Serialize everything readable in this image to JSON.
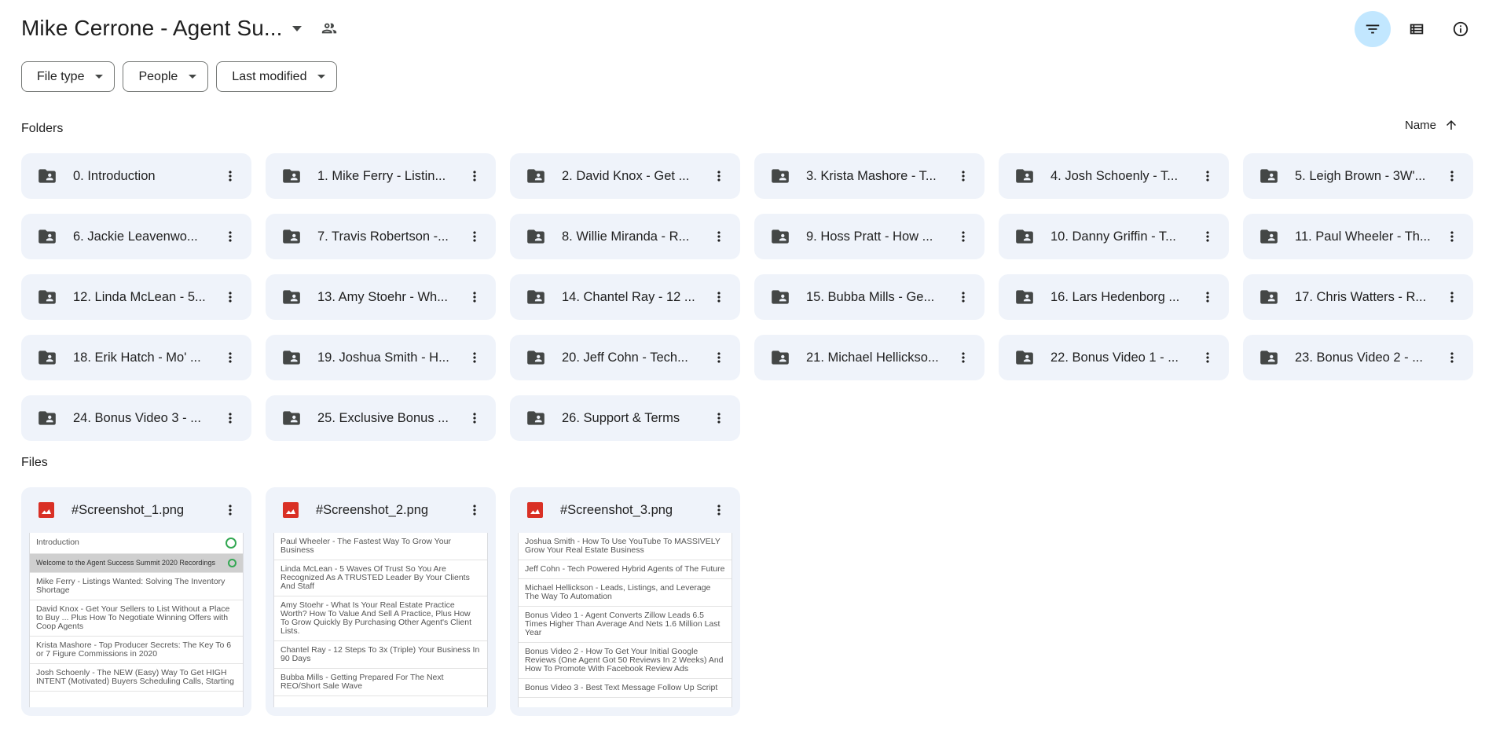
{
  "header": {
    "title": "Mike Cerrone - Agent Su...",
    "icons": [
      "caret-down-icon",
      "shared-people-icon"
    ]
  },
  "toolbar": {
    "icons": [
      "filter-icon",
      "list-view-icon",
      "info-icon"
    ],
    "active_color": "#c2e7ff"
  },
  "filters": [
    {
      "label": "File type"
    },
    {
      "label": "People"
    },
    {
      "label": "Last modified"
    }
  ],
  "folders_label": "Folders",
  "sort": {
    "label": "Name",
    "icon": "arrow-up-icon"
  },
  "folders": [
    {
      "name": "0. Introduction"
    },
    {
      "name": "1. Mike Ferry - Listin..."
    },
    {
      "name": "2. David Knox - Get ..."
    },
    {
      "name": "3. Krista Mashore - T..."
    },
    {
      "name": "4. Josh Schoenly - T..."
    },
    {
      "name": "5. Leigh Brown - 3W'..."
    },
    {
      "name": "6. Jackie Leavenwo..."
    },
    {
      "name": "7. Travis Robertson -..."
    },
    {
      "name": "8. Willie Miranda - R..."
    },
    {
      "name": "9. Hoss Pratt - How ..."
    },
    {
      "name": "10. Danny Griffin - T..."
    },
    {
      "name": "11. Paul Wheeler - Th..."
    },
    {
      "name": "12. Linda McLean - 5..."
    },
    {
      "name": "13. Amy Stoehr - Wh..."
    },
    {
      "name": "14. Chantel Ray - 12 ..."
    },
    {
      "name": "15. Bubba Mills - Ge..."
    },
    {
      "name": "16. Lars Hedenborg ..."
    },
    {
      "name": "17. Chris Watters - R..."
    },
    {
      "name": "18. Erik Hatch - Mo' ..."
    },
    {
      "name": "19. Joshua Smith - H..."
    },
    {
      "name": "20. Jeff Cohn - Tech..."
    },
    {
      "name": "21. Michael Hellickso..."
    },
    {
      "name": "22. Bonus Video 1 - ..."
    },
    {
      "name": "23. Bonus Video 2 - ..."
    },
    {
      "name": "24. Bonus Video 3 - ..."
    },
    {
      "name": "25. Exclusive Bonus ..."
    },
    {
      "name": "26. Support & Terms"
    }
  ],
  "files_label": "Files",
  "files": [
    {
      "name": "#Screenshot_1.png",
      "preview": [
        {
          "text": "Introduction",
          "ring": true
        },
        {
          "text": "Welcome to the Agent Success Summit 2020 Recordings",
          "ring": true,
          "hl": true
        },
        {
          "text": "Mike Ferry - Listings Wanted: Solving The Inventory Shortage"
        },
        {
          "text": "David Knox - Get Your Sellers to List Without a Place to Buy ... Plus How To Negotiate Winning Offers with Coop Agents"
        },
        {
          "text": "Krista Mashore - Top Producer Secrets: The Key To 6 or 7 Figure Commissions in 2020"
        },
        {
          "text": "Josh Schoenly - The NEW (Easy) Way To Get HIGH INTENT (Motivated) Buyers Scheduling Calls, Starting"
        }
      ]
    },
    {
      "name": "#Screenshot_2.png",
      "preview": [
        {
          "text": "Paul Wheeler - The Fastest Way To Grow Your Business"
        },
        {
          "text": "Linda McLean - 5 Waves Of Trust So You Are Recognized As A TRUSTED Leader By Your Clients And Staff"
        },
        {
          "text": "Amy Stoehr - What Is Your Real Estate Practice Worth? How To Value And Sell A Practice, Plus How To Grow Quickly By Purchasing Other Agent's Client Lists."
        },
        {
          "text": "Chantel Ray - 12 Steps To 3x (Triple) Your Business In 90 Days"
        },
        {
          "text": "Bubba Mills - Getting Prepared For The Next REO/Short Sale Wave"
        }
      ]
    },
    {
      "name": "#Screenshot_3.png",
      "preview": [
        {
          "text": "Joshua Smith - How To Use YouTube To MASSIVELY Grow Your Real Estate Business"
        },
        {
          "text": "Jeff Cohn - Tech Powered Hybrid Agents of The Future"
        },
        {
          "text": "Michael Hellickson - Leads, Listings, and Leverage The Way To Automation"
        },
        {
          "text": "Bonus Video 1 - Agent Converts Zillow Leads 6.5 Times Higher Than Average And Nets 1.6 Million Last Year"
        },
        {
          "text": "Bonus Video 2 - How To Get Your Initial Google Reviews (One Agent Got 50 Reviews In 2 Weeks) And How To Promote With Facebook Review Ads"
        },
        {
          "text": "Bonus Video 3 - Best Text Message Follow Up Script"
        }
      ]
    }
  ],
  "colors": {
    "card_bg": "#eff3fa",
    "folder_icon": "#444746",
    "image_icon": "#d93025"
  }
}
